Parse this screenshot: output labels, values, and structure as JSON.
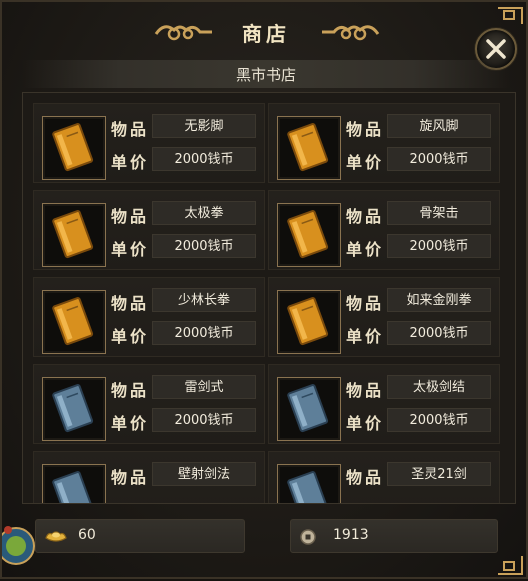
{
  "window": {
    "title": "商店",
    "subtitle": "黑市书店",
    "close_label": "close"
  },
  "labels": {
    "name": "物品",
    "price": "单价"
  },
  "items": [
    {
      "name": "无影脚",
      "price": "2000钱币",
      "book": "orange"
    },
    {
      "name": "旋风脚",
      "price": "2000钱币",
      "book": "orange"
    },
    {
      "name": "太极拳",
      "price": "2000钱币",
      "book": "orange"
    },
    {
      "name": "骨架击",
      "price": "2000钱币",
      "book": "orange"
    },
    {
      "name": "少林长拳",
      "price": "2000钱币",
      "book": "orange"
    },
    {
      "name": "如来金刚拳",
      "price": "2000钱币",
      "book": "orange"
    },
    {
      "name": "雷剑式",
      "price": "2000钱币",
      "book": "blue"
    },
    {
      "name": "太极剑结",
      "price": "2000钱币",
      "book": "blue"
    },
    {
      "name": "壁射剑法",
      "price": "",
      "book": "blue"
    },
    {
      "name": "圣灵21剑",
      "price": "",
      "book": "blue"
    }
  ],
  "currency": {
    "gold": {
      "icon": "gold-ingot-icon",
      "amount": "60"
    },
    "coin": {
      "icon": "copper-coin-icon",
      "amount": "1913"
    }
  },
  "colors": {
    "accent_gold": "#c9a15a",
    "book_orange": "#d8901e",
    "book_blue": "#5e7f99"
  }
}
